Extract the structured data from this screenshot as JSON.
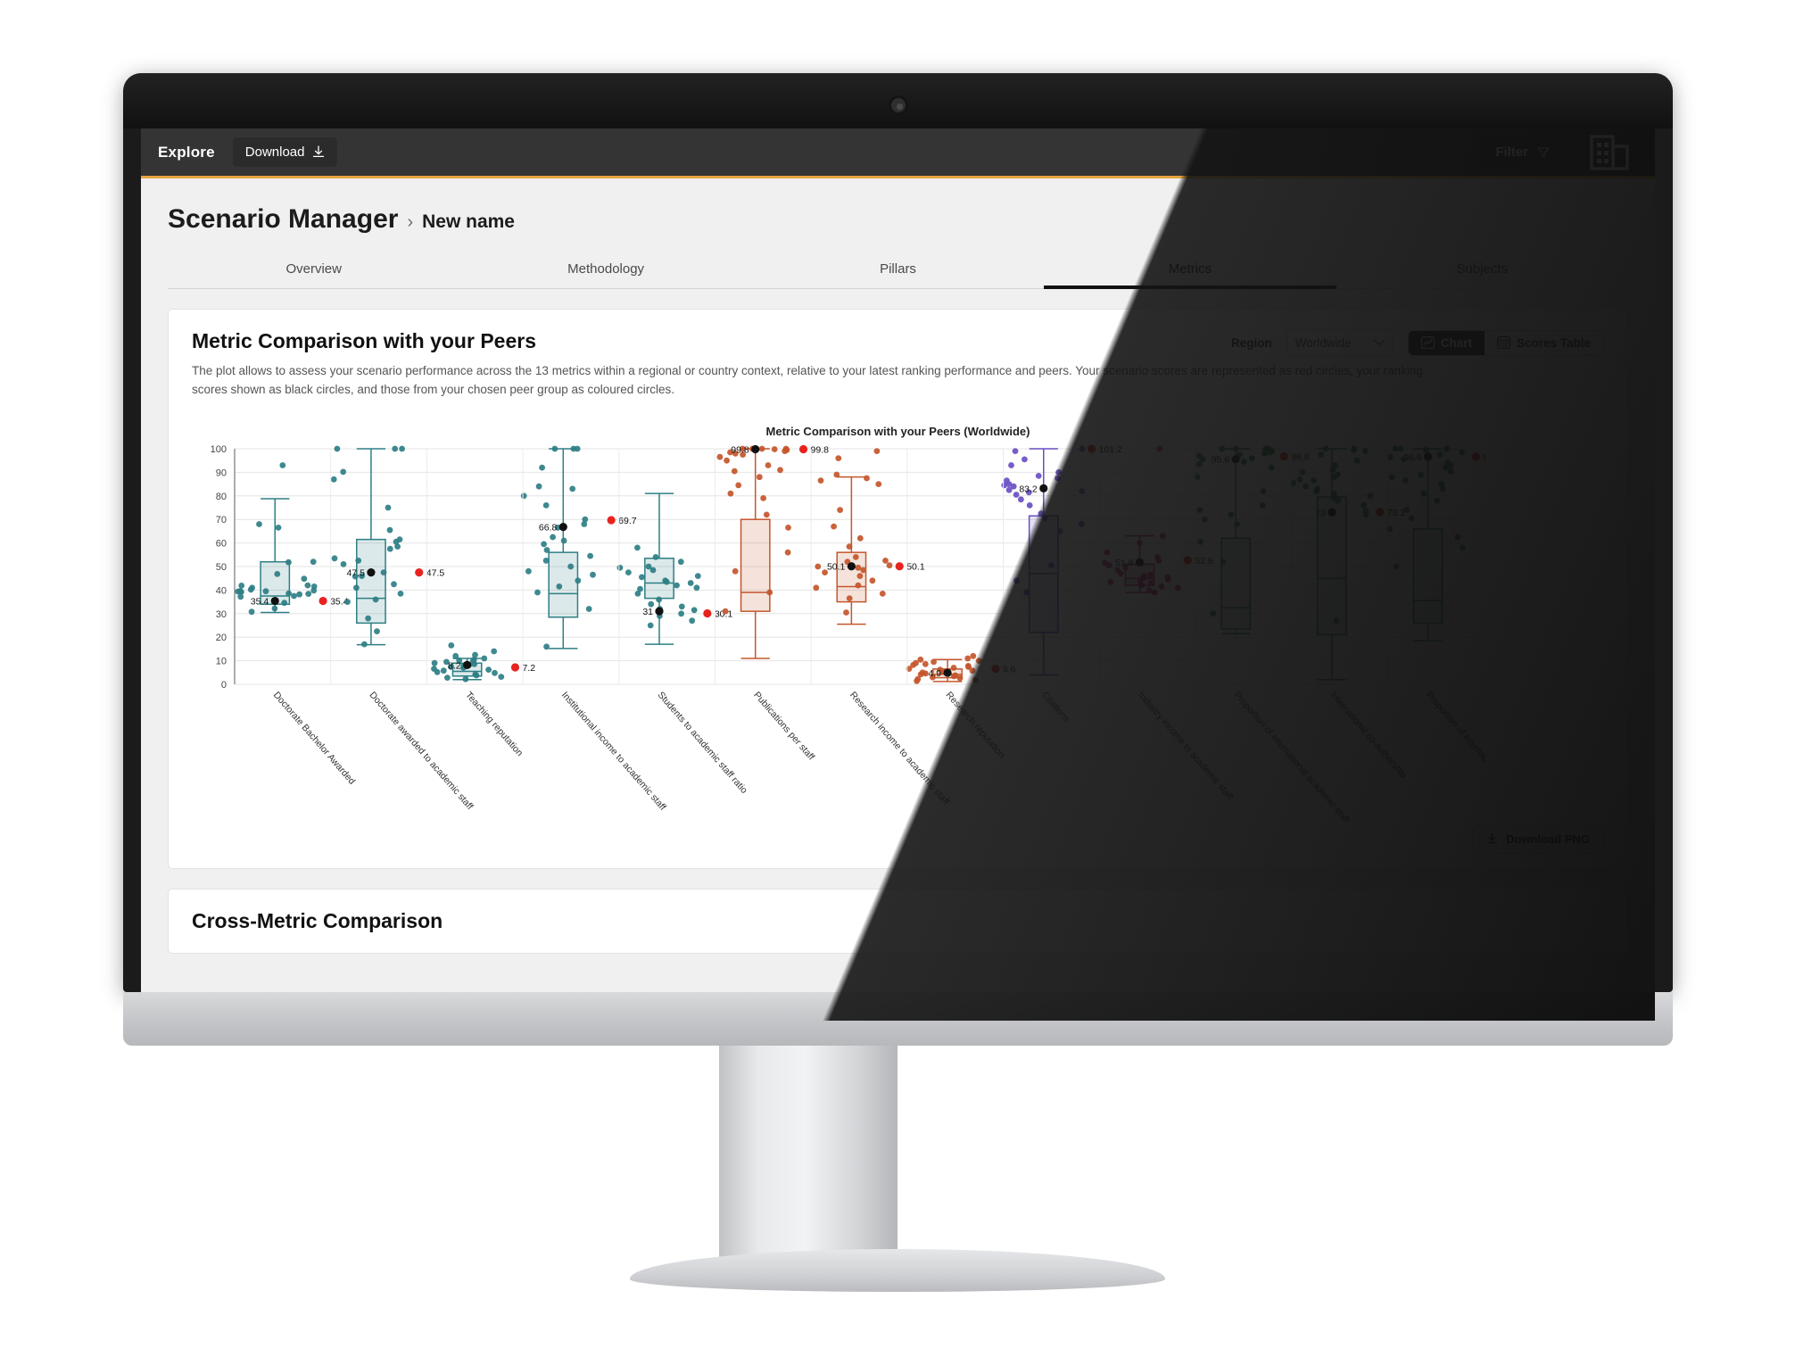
{
  "topbar": {
    "explore": "Explore",
    "download_label": "Download",
    "download_icon": "download-icon",
    "filter_label": "Filter",
    "filter_icon": "filter-funnel-icon",
    "logo_icon": "building-logo-icon",
    "accent": "#e8a33d",
    "bg": "#343434"
  },
  "breadcrumb": {
    "main": "Scenario Manager",
    "separator": "›",
    "sub": "New name"
  },
  "tabs": [
    {
      "label": "Overview",
      "active": false
    },
    {
      "label": "Methodology",
      "active": false
    },
    {
      "label": "Pillars",
      "active": false
    },
    {
      "label": "Metrics",
      "active": true
    },
    {
      "label": "Subjects",
      "active": false
    }
  ],
  "card": {
    "title": "Metric Comparison with your Peers",
    "description": "The plot allows to assess your scenario performance across the 13 metrics within a regional or country context, relative to your latest ranking performance and peers. Your scenario scores are represented as red circles, your ranking scores shown as black circles, and those from your chosen peer group as coloured circles.",
    "region_label": "Region",
    "region_value": "Worldwide",
    "region_options": [
      "Worldwide"
    ],
    "chevron_icon": "chevron-down-icon",
    "toggle": [
      {
        "label": "Chart",
        "icon": "line-chart-icon",
        "active": true
      },
      {
        "label": "Scores Table",
        "icon": "table-icon",
        "active": false
      }
    ],
    "download_png_label": "Download PNG",
    "download_png_icon": "download-icon"
  },
  "card2": {
    "title": "Cross-Metric Comparison"
  },
  "chart_data": {
    "type": "box",
    "title": "Metric Comparison with your Peers (Worldwide)",
    "xlabel": "",
    "ylabel": "",
    "ylim": [
      0,
      100
    ],
    "yticks": [
      0,
      10,
      20,
      30,
      40,
      50,
      60,
      70,
      80,
      90,
      100
    ],
    "grid": true,
    "legend": "none",
    "series_colors": {
      "scenario": "#e8231f",
      "ranking": "#111111"
    },
    "categories": [
      "Doctorate Bachelor Awarded",
      "Doctorate awarded to academic staff",
      "Teaching reputation",
      "Institutional income to academic staff",
      "Students to academic staff ratio",
      "Publications per staff",
      "Research income to academic staff",
      "Research reputation",
      "Citations",
      "Industry income to academic staff",
      "Proportion of international academic staff",
      "International co-authorship",
      "Proportion of international students"
    ],
    "boxes": [
      {
        "category": "Doctorate Bachelor Awarded",
        "color": "#2e7f85",
        "min": 30.5,
        "q1": 34.0,
        "median": 37.5,
        "q3": 52.0,
        "max": 78.8,
        "ranking_score": 35.4,
        "scenario_score": 35.4,
        "ranking_label": "35.4",
        "scenario_label": "35.4"
      },
      {
        "category": "Doctorate awarded to academic staff",
        "color": "#2e7f85",
        "min": 16.8,
        "q1": 26.0,
        "median": 36.5,
        "q3": 61.5,
        "max": 100.0,
        "ranking_score": 47.5,
        "scenario_score": 47.5,
        "ranking_label": "47.5",
        "scenario_label": "47.5"
      },
      {
        "category": "Teaching reputation",
        "color": "#2e7f85",
        "min": 2.0,
        "q1": 3.5,
        "median": 5.5,
        "q3": 9.0,
        "max": 11.0,
        "ranking_score": 8.2,
        "scenario_score": 7.2,
        "ranking_label": "8.2",
        "scenario_label": "7.2"
      },
      {
        "category": "Institutional income to academic staff",
        "color": "#2e7f85",
        "min": 15.2,
        "q1": 28.5,
        "median": 38.5,
        "q3": 56.0,
        "max": 100.0,
        "ranking_score": 66.8,
        "scenario_score": 69.7,
        "ranking_label": "66.8",
        "scenario_label": "69.7"
      },
      {
        "category": "Students to academic staff ratio",
        "color": "#2e7f85",
        "min": 17.0,
        "q1": 36.5,
        "median": 43.0,
        "q3": 53.5,
        "max": 81.0,
        "ranking_score": 31.0,
        "scenario_score": 30.1,
        "ranking_label": "31",
        "scenario_label": "30.1"
      },
      {
        "category": "Publications per staff",
        "color": "#c4562b",
        "min": 11.0,
        "q1": 31.0,
        "median": 39.0,
        "q3": 70.0,
        "max": 100.0,
        "ranking_score": 99.8,
        "scenario_score": 99.8,
        "ranking_label": "99.8",
        "scenario_label": "99.8"
      },
      {
        "category": "Research income to academic staff",
        "color": "#c4562b",
        "min": 25.5,
        "q1": 35.0,
        "median": 41.5,
        "q3": 56.0,
        "max": 88.0,
        "ranking_score": 50.1,
        "scenario_score": 50.1,
        "ranking_label": "50.1",
        "scenario_label": "50.1"
      },
      {
        "category": "Research reputation",
        "color": "#c4562b",
        "min": 1.2,
        "q1": 2.8,
        "median": 4.2,
        "q3": 6.5,
        "max": 10.5,
        "ranking_score": 4.9,
        "scenario_score": 6.6,
        "ranking_label": "4.9",
        "scenario_label": "6.6"
      },
      {
        "category": "Citations",
        "color": "#6a4fc4",
        "min": 4.0,
        "q1": 22.0,
        "median": 47.0,
        "q3": 71.5,
        "max": 100.0,
        "ranking_score": 83.2,
        "scenario_score": 101.2,
        "ranking_label": "83.2",
        "scenario_label": "101.2"
      },
      {
        "category": "Industry income to academic staff",
        "color": "#c42a7d",
        "min": 39.0,
        "q1": 42.0,
        "median": 45.0,
        "q3": 51.0,
        "max": 63.0,
        "ranking_score": 51.8,
        "scenario_score": 52.6,
        "ranking_label": "51.8",
        "scenario_label": "52.6"
      },
      {
        "category": "Proportion of international academic staff",
        "color": "#2e8b57",
        "min": 21.5,
        "q1": 23.5,
        "median": 32.5,
        "q3": 62.0,
        "max": 100.0,
        "ranking_score": 95.6,
        "scenario_score": 96.8,
        "ranking_label": "95.6",
        "scenario_label": "96.8"
      },
      {
        "category": "International co-authorship",
        "color": "#2e8b57",
        "min": 2.0,
        "q1": 21.0,
        "median": 45.0,
        "q3": 79.5,
        "max": 100.0,
        "ranking_score": 73.0,
        "scenario_score": 73.1,
        "ranking_label": "73",
        "scenario_label": "73.1"
      },
      {
        "category": "Proportion of international students",
        "color": "#2e8b57",
        "min": 18.5,
        "q1": 26.0,
        "median": 35.5,
        "q3": 66.0,
        "max": 100.0,
        "ranking_score": 96.6,
        "scenario_score": 96.6,
        "ranking_label": "96.6",
        "scenario_label": "96.6"
      }
    ],
    "peer_points": [
      {
        "category": "Doctorate Bachelor Awarded",
        "values": [
          93.0,
          68.0,
          66.5,
          52.0,
          51.8,
          46.8,
          44.8,
          42.0,
          41.9,
          41.5,
          41.0,
          40.2,
          39.8,
          39.6,
          39.5,
          39.4,
          39.2,
          38.6,
          38.4,
          38.2,
          37.5,
          37.2,
          34.6,
          32.2,
          30.8
        ]
      },
      {
        "category": "Doctorate awarded to academic staff",
        "values": [
          100.0,
          100.0,
          100.0,
          90.2,
          87.0,
          75.0,
          65.5,
          61.5,
          60.5,
          58.5,
          57.5,
          53.5,
          52.5,
          51.0,
          47.5,
          46.0,
          45.8,
          42.5,
          41.0,
          38.5,
          36.0,
          35.0,
          28.0,
          22.5,
          17.0
        ]
      },
      {
        "category": "Teaching reputation",
        "values": [
          16.5,
          14.0,
          12.5,
          12.0,
          11.0,
          10.5,
          10.2,
          9.8,
          9.5,
          9.0,
          8.6,
          8.2,
          7.8,
          7.4,
          7.0,
          6.6,
          6.2,
          5.8,
          5.2,
          4.8,
          4.2,
          3.8,
          3.2,
          2.8,
          2.2
        ]
      },
      {
        "category": "Institutional income to academic staff",
        "values": [
          100.0,
          100.0,
          100.0,
          92.0,
          84.0,
          83.0,
          80.0,
          76.0,
          70.0,
          68.0,
          66.5,
          62.5,
          61.0,
          59.5,
          57.0,
          54.5,
          52.5,
          50.0,
          48.0,
          46.5,
          44.0,
          41.5,
          39.0,
          32.0,
          16.0
        ]
      },
      {
        "category": "Students to academic staff ratio",
        "values": [
          58.0,
          54.0,
          52.0,
          50.0,
          49.5,
          48.5,
          47.5,
          46.0,
          45.5,
          44.0,
          43.5,
          43.0,
          42.0,
          41.0,
          40.5,
          38.5,
          36.0,
          34.0,
          33.0,
          32.0,
          31.5,
          30.0,
          29.0,
          27.0,
          25.0
        ]
      },
      {
        "category": "Publications per staff",
        "values": [
          100.0,
          100.0,
          100.0,
          100.0,
          99.8,
          99.5,
          99.0,
          98.5,
          98.0,
          97.5,
          96.5,
          95.0,
          93.0,
          91.0,
          90.5,
          88.0,
          84.5,
          81.0,
          79.0,
          72.0,
          66.5,
          56.0,
          48.0,
          39.0,
          31.0
        ]
      },
      {
        "category": "Research income to academic staff",
        "values": [
          99.0,
          96.0,
          89.0,
          87.5,
          86.5,
          85.0,
          74.0,
          67.0,
          62.0,
          58.5,
          54.0,
          52.5,
          52.0,
          50.5,
          50.0,
          49.5,
          48.5,
          47.5,
          46.0,
          44.0,
          42.0,
          41.0,
          38.5,
          36.5,
          30.5
        ]
      },
      {
        "category": "Research reputation",
        "values": [
          12.0,
          11.0,
          10.5,
          10.0,
          9.5,
          9.0,
          8.6,
          8.2,
          7.8,
          7.4,
          7.0,
          6.6,
          6.2,
          5.8,
          5.4,
          5.0,
          4.6,
          4.2,
          3.8,
          3.4,
          3.0,
          2.6,
          2.2,
          1.8,
          1.4
        ]
      },
      {
        "category": "Citations",
        "values": [
          100.0,
          99.0,
          95.5,
          93.0,
          90.0,
          88.5,
          87.5,
          86.5,
          85.0,
          84.5,
          84.0,
          83.5,
          82.5,
          82.0,
          81.5,
          80.5,
          78.5,
          76.0,
          72.5,
          70.5,
          68.0,
          65.0,
          50.5,
          44.0,
          39.0
        ]
      },
      {
        "category": "Industry income to academic staff",
        "values": [
          63.0,
          101.0,
          60.0,
          56.0,
          54.0,
          52.5,
          51.5,
          50.5,
          49.5,
          48.5,
          47.0,
          46.5,
          46.0,
          45.5,
          45.0,
          44.5,
          44.0,
          43.5,
          43.0,
          42.5,
          42.0,
          41.5,
          41.0,
          40.0,
          39.0
        ]
      },
      {
        "category": "Proportion of international academic staff",
        "values": [
          100.0,
          100.0,
          100.0,
          100.0,
          99.5,
          99.0,
          98.5,
          98.0,
          97.5,
          97.0,
          96.0,
          95.5,
          94.5,
          93.5,
          92.0,
          88.0,
          82.0,
          76.0,
          74.0,
          72.0,
          70.0,
          68.0,
          60.5,
          52.0,
          30.0
        ]
      },
      {
        "category": "International co-authorship",
        "values": [
          100.0,
          100.0,
          99.5,
          99.0,
          97.5,
          95.0,
          93.0,
          91.0,
          90.0,
          89.0,
          88.0,
          87.0,
          86.5,
          85.5,
          84.0,
          83.0,
          82.0,
          81.0,
          80.0,
          79.0,
          78.0,
          76.0,
          73.5,
          72.0,
          27.0
        ]
      },
      {
        "category": "Proportion of international students",
        "values": [
          100.0,
          100.0,
          100.0,
          99.5,
          98.5,
          97.5,
          96.5,
          95.5,
          94.0,
          93.0,
          92.0,
          90.5,
          89.0,
          88.0,
          86.5,
          85.0,
          83.0,
          81.0,
          78.0,
          74.0,
          70.5,
          66.0,
          62.5,
          58.0,
          50.0
        ]
      }
    ]
  }
}
